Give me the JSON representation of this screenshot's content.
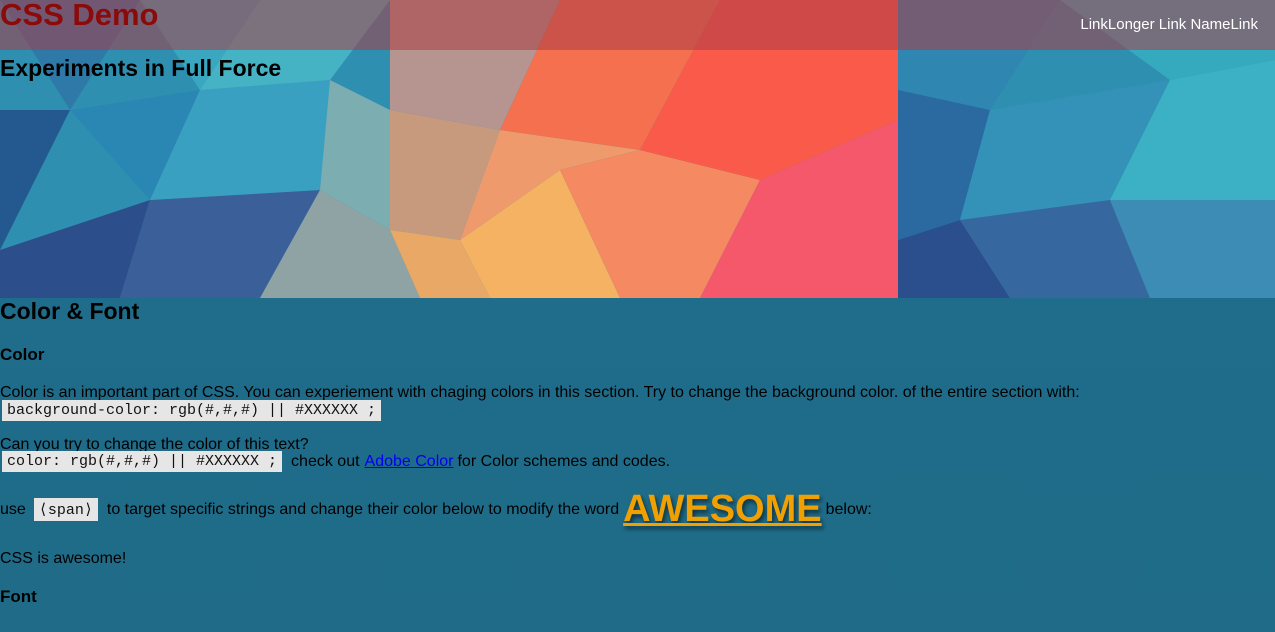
{
  "header": {
    "title": "CSS Demo",
    "nav": [
      "Link",
      "Longer Link Name",
      "Link"
    ],
    "subtitle": "Experiments in Full Force"
  },
  "section": {
    "title": "Color & Font",
    "color": {
      "heading": "Color",
      "intro": "Color is an important part of CSS. You can experiement with chaging colors in this section. Try to change the background color. of the entire section with:",
      "bg_code": "background-color: rgb(#,#,#) || #XXXXXX ;",
      "text_prompt": "Can you try to change the color of this text?",
      "color_code": "color: rgb(#,#,#) || #XXXXXX ;",
      "check_out": "check out",
      "adobe_link": "Adobe Color",
      "schemes_text": "for Color schemes and codes.",
      "use_text": "use",
      "span_code": "⟨span⟩",
      "target_text": "to target specific strings and change their color below to modify the word",
      "awesome_word": "AWESOME",
      "below_text": "below:",
      "css_awesome": "CSS is awesome!"
    },
    "font": {
      "heading": "Font"
    }
  },
  "colors": {
    "header_bar": "#aa3c46",
    "title_color": "#8b0a0a",
    "section_bg": "#1e6e8c",
    "awesome": "#f0a000",
    "link": "#0000ee"
  }
}
